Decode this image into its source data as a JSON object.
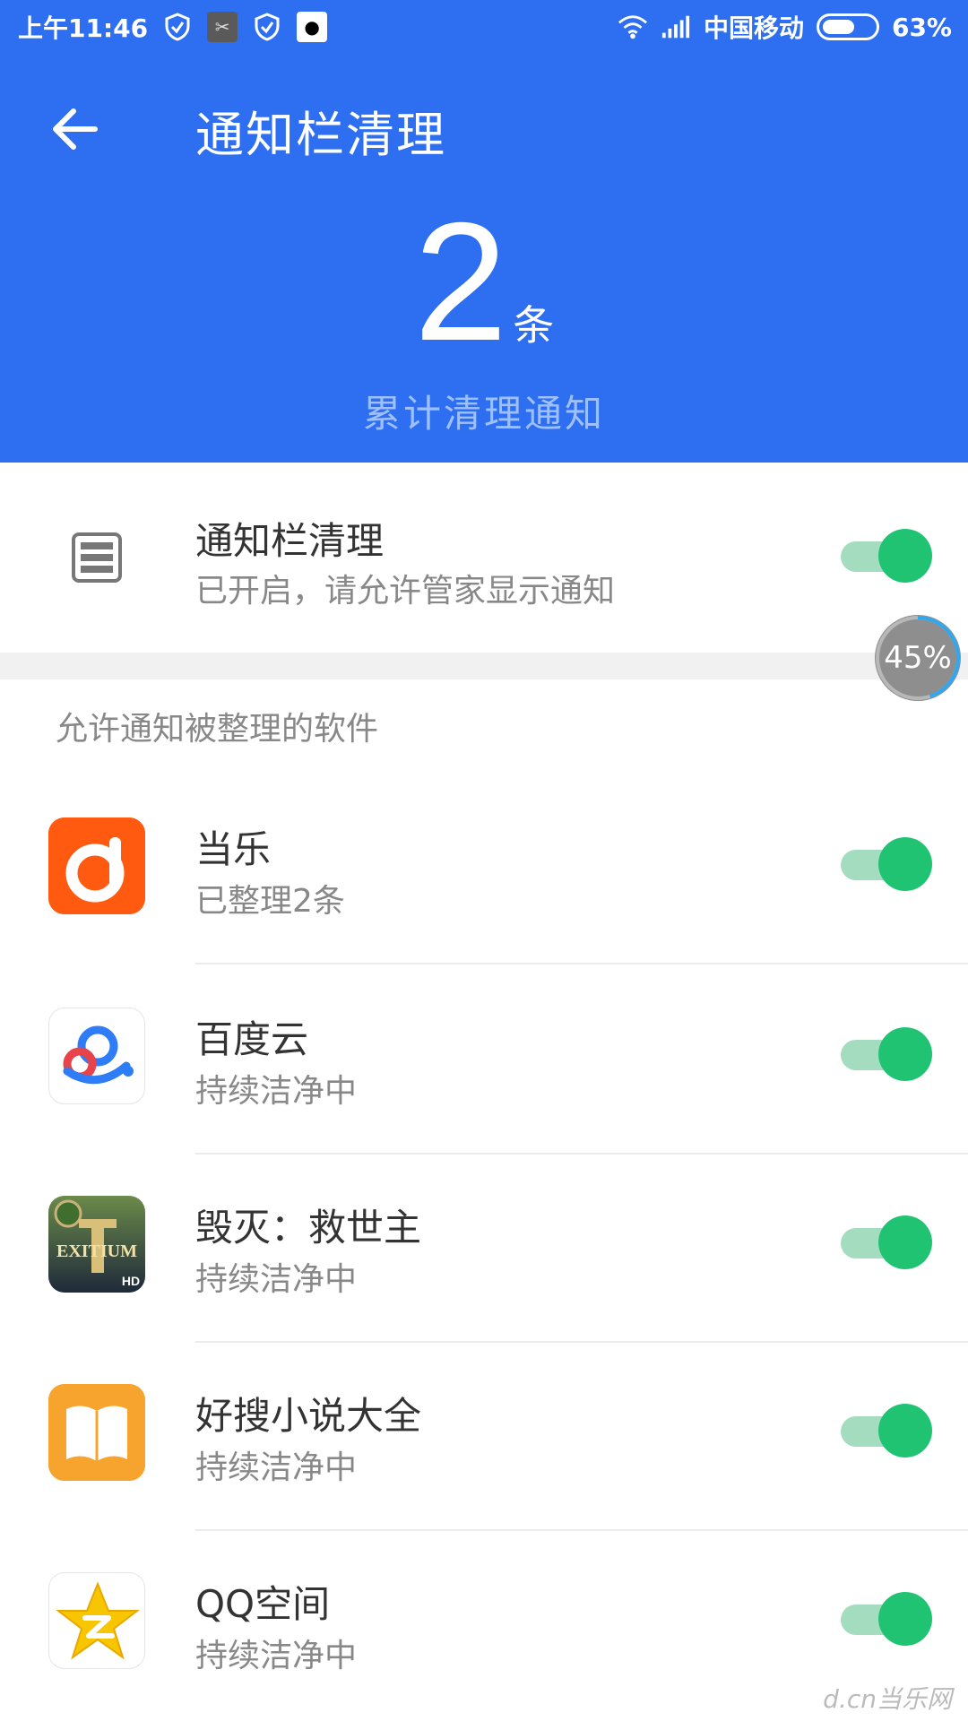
{
  "status_bar": {
    "time": "上午11:46",
    "carrier": "中国移动",
    "battery_percent": "63%",
    "battery_level": 0.63,
    "icons": [
      "shield-icon",
      "camera-app-icon",
      "shield-icon",
      "qq-icon",
      "wifi-icon",
      "signal-icon",
      "battery-icon"
    ]
  },
  "header": {
    "title": "通知栏清理",
    "count": "2",
    "count_unit": "条",
    "subtitle": "累计清理通知"
  },
  "master": {
    "title": "通知栏清理",
    "subtitle": "已开启，请允许管家显示通知",
    "enabled": true,
    "icon": "notification-list-icon"
  },
  "progress_bubble": {
    "label": "45%",
    "value": 0.45
  },
  "section_label": "允许通知被整理的软件",
  "apps": [
    {
      "name": "当乐",
      "status": "已整理2条",
      "enabled": true,
      "icon": "dangle-app-icon",
      "color": "#ff6a1a"
    },
    {
      "name": "百度云",
      "status": "持续洁净中",
      "enabled": true,
      "icon": "baidu-cloud-app-icon",
      "color": "#2e7cf6"
    },
    {
      "name": "毁灭：救世主",
      "status": "持续洁净中",
      "enabled": true,
      "icon": "exitium-app-icon",
      "color": "#3b4a2a"
    },
    {
      "name": "好搜小说大全",
      "status": "持续洁净中",
      "enabled": true,
      "icon": "novel-app-icon",
      "color": "#f7a42f"
    },
    {
      "name": "QQ空间",
      "status": "持续洁净中",
      "enabled": true,
      "icon": "qzone-app-icon",
      "color": "#f5c400"
    }
  ],
  "colors": {
    "header_bg": "#2d6ff0",
    "toggle_on": "#20c372",
    "toggle_track": "#a4dcc0"
  },
  "watermark": "d.cn当乐网"
}
